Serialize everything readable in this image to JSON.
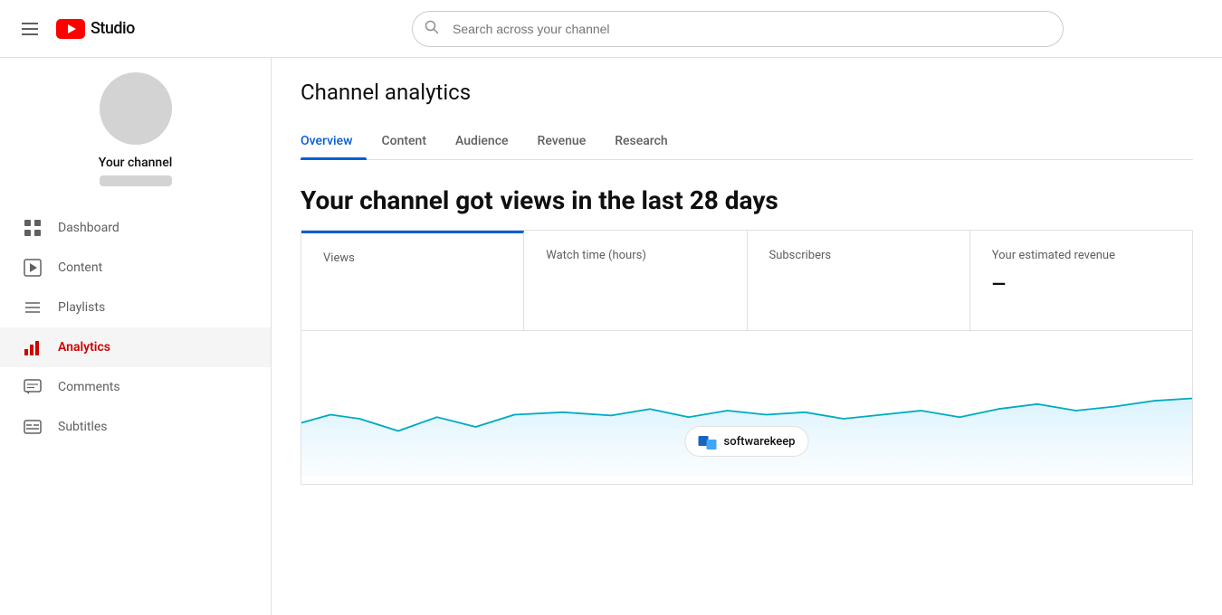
{
  "header": {
    "menu_label": "Menu",
    "logo_text": "Studio",
    "search_placeholder": "Search across your channel"
  },
  "sidebar": {
    "channel_name": "Your channel",
    "nav_items": [
      {
        "id": "dashboard",
        "label": "Dashboard",
        "icon": "⊞",
        "active": false
      },
      {
        "id": "content",
        "label": "Content",
        "icon": "▶",
        "active": false
      },
      {
        "id": "playlists",
        "label": "Playlists",
        "icon": "≡",
        "active": false
      },
      {
        "id": "analytics",
        "label": "Analytics",
        "icon": "📊",
        "active": true
      },
      {
        "id": "comments",
        "label": "Comments",
        "icon": "💬",
        "active": false
      },
      {
        "id": "subtitles",
        "label": "Subtitles",
        "icon": "⬛",
        "active": false
      }
    ]
  },
  "main": {
    "page_title": "Channel analytics",
    "tabs": [
      {
        "id": "overview",
        "label": "Overview",
        "active": true
      },
      {
        "id": "content",
        "label": "Content",
        "active": false
      },
      {
        "id": "audience",
        "label": "Audience",
        "active": false
      },
      {
        "id": "revenue",
        "label": "Revenue",
        "active": false
      },
      {
        "id": "research",
        "label": "Research",
        "active": false
      }
    ],
    "headline_prefix": "Your channel got",
    "headline_suffix": "views in the last 28 days",
    "stat_cards": [
      {
        "id": "views",
        "label": "Views",
        "value": "",
        "active_tab": true
      },
      {
        "id": "watch_time",
        "label": "Watch time (hours)",
        "value": ""
      },
      {
        "id": "subscribers",
        "label": "Subscribers",
        "value": ""
      },
      {
        "id": "revenue",
        "label": "Your estimated revenue",
        "value": "—"
      }
    ],
    "watermark_text": "softwarekeep"
  }
}
